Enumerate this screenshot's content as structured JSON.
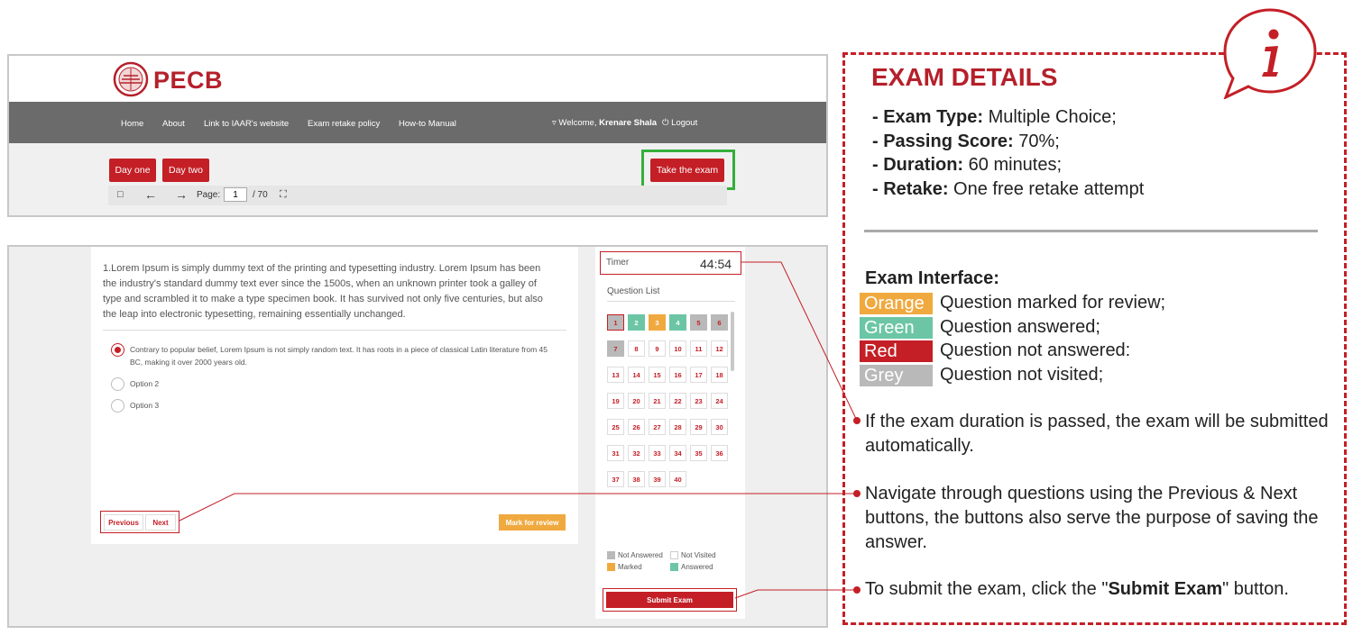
{
  "brand": {
    "name": "PECB"
  },
  "nav": {
    "links": [
      "Home",
      "About",
      "Link to IAAR's website",
      "Exam retake policy",
      "How-to Manual"
    ],
    "welcome_prefix": "Welcome,",
    "user_name": "Krenare Shala",
    "logout": "Logout"
  },
  "days": {
    "day_one": "Day one",
    "day_two": "Day two"
  },
  "take_exam_label": "Take the exam",
  "viewer": {
    "page_label": "Page:",
    "page_value": "1",
    "page_total": "/ 70"
  },
  "question": {
    "text": "1.Lorem Ipsum is simply dummy text of the printing and typesetting industry. Lorem Ipsum has been the industry's standard dummy text ever since the 1500s, when an unknown printer took a galley of type and scrambled it to make a type specimen book. It has survived not only five centuries, but also the leap into electronic typesetting, remaining essentially unchanged.",
    "options": [
      "Contrary to popular belief, Lorem Ipsum is not simply random text. It has roots in a piece of classical Latin literature from 45 BC, making it over 2000 years old.",
      "Option 2",
      "Option 3"
    ],
    "selected_option": 0,
    "previous_label": "Previous",
    "next_label": "Next",
    "mark_review_label": "Mark for review"
  },
  "timer": {
    "label": "Timer",
    "value": "44:54"
  },
  "question_list": {
    "label": "Question List",
    "numbers": [
      "1",
      "2",
      "3",
      "4",
      "5",
      "6",
      "7",
      "8",
      "9",
      "10",
      "11",
      "12",
      "13",
      "14",
      "15",
      "16",
      "17",
      "18",
      "19",
      "20",
      "21",
      "22",
      "23",
      "24",
      "25",
      "26",
      "27",
      "28",
      "29",
      "30",
      "31",
      "32",
      "33",
      "34",
      "35",
      "36",
      "37",
      "38",
      "39",
      "40"
    ],
    "states": [
      "grey",
      "green",
      "orange",
      "green",
      "grey",
      "grey",
      "grey",
      "white",
      "white",
      "white",
      "white",
      "white",
      "white",
      "white",
      "white",
      "white",
      "white",
      "white",
      "white",
      "white",
      "white",
      "white",
      "white",
      "white",
      "white",
      "white",
      "white",
      "white",
      "white",
      "white",
      "white",
      "white",
      "white",
      "white",
      "white",
      "white",
      "white",
      "white",
      "white",
      "white"
    ]
  },
  "legend": {
    "not_answered": "Not Answered",
    "not_visited": "Not Visited",
    "marked": "Marked",
    "answered": "Answered"
  },
  "submit_label": "Submit Exam",
  "info": {
    "title": "EXAM DETAILS",
    "details": [
      {
        "key": "- Exam Type:",
        "value": "Multiple Choice;"
      },
      {
        "key": "- Passing Score:",
        "value": "70%;"
      },
      {
        "key": "- Duration:",
        "value": "60 minutes;"
      },
      {
        "key": "- Retake:",
        "value": "One free retake attempt"
      }
    ],
    "interface_title": "Exam Interface:",
    "colors": [
      {
        "name": "Orange",
        "desc": "Question marked for review;",
        "hex": "#f0a93f"
      },
      {
        "name": "Green",
        "desc": "Question answered;",
        "hex": "#6cc6a6"
      },
      {
        "name": "Red",
        "desc": "Question not answered:",
        "hex": "#c41f26"
      },
      {
        "name": "Grey",
        "desc": "Question not visited;",
        "hex": "#b9b9b9"
      }
    ],
    "note_duration": "If the exam duration is passed, the exam will be submitted automatically.",
    "note_navigate": "Navigate through questions using the Previous & Next buttons, the buttons also serve the purpose of saving the answer.",
    "note_submit_prefix": "To submit the exam, click the \"",
    "note_submit_bold": "Submit Exam",
    "note_submit_suffix": "\" button."
  },
  "colors": {
    "brand_red": "#c41f26",
    "highlight_green": "#35ae3c",
    "nav_grey": "#6b6b6b"
  }
}
